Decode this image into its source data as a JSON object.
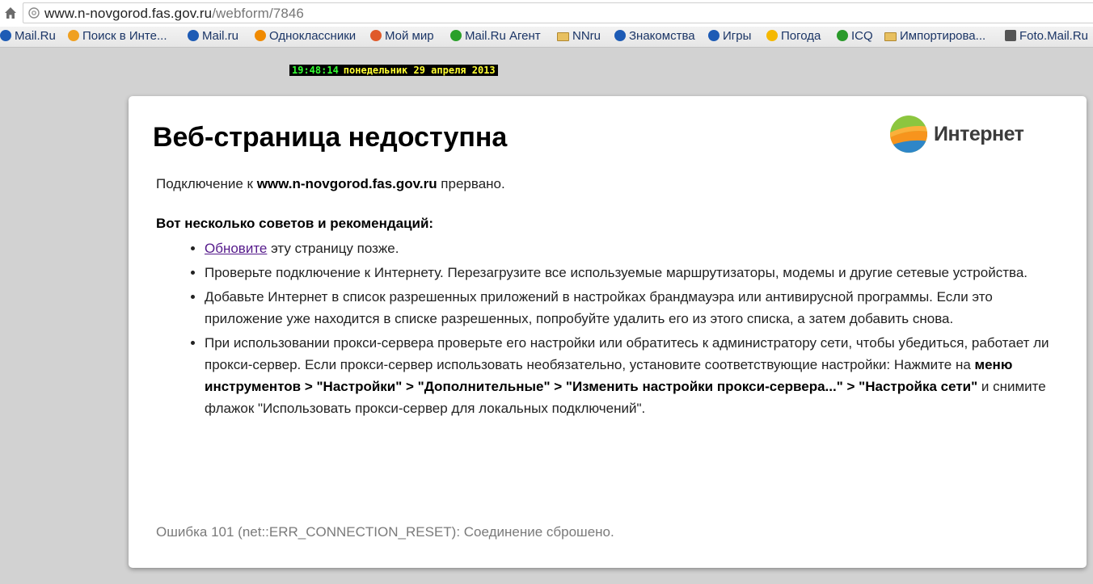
{
  "address_bar": {
    "url_host": "www.n-novgorod.fas.gov.ru",
    "url_path": "/webform/7846"
  },
  "bookmarks": [
    {
      "label": "Mail.Ru",
      "icon": "mailru-at-icon",
      "color": "#1d5bb5"
    },
    {
      "label": "Поиск в Инте...",
      "icon": "search-icon",
      "color": "#f0a020"
    },
    {
      "label": "Mail.ru",
      "icon": "mailru-at-icon",
      "color": "#1d5bb5"
    },
    {
      "label": "Одноклассники",
      "icon": "odnoklassniki-icon",
      "color": "#f08a00"
    },
    {
      "label": "Мой мир",
      "icon": "people-icon",
      "color": "#e05a2a"
    },
    {
      "label": "Mail.Ru Агент",
      "icon": "agent-icon",
      "color": "#2aa02a"
    },
    {
      "label": "NNru",
      "icon": "folder-icon",
      "color": "#e8c060"
    },
    {
      "label": "Знакомства",
      "icon": "at-icon",
      "color": "#1d5bb5"
    },
    {
      "label": "Игры",
      "icon": "mailru-at-icon",
      "color": "#1d5bb5"
    },
    {
      "label": "Погода",
      "icon": "weather-icon",
      "color": "#f5b800"
    },
    {
      "label": "ICQ",
      "icon": "icq-flower-icon",
      "color": "#2a9a2a"
    },
    {
      "label": "Импортирова...",
      "icon": "folder-icon",
      "color": "#e8c060"
    },
    {
      "label": "Foto.Mail.Ru",
      "icon": "camera-icon",
      "color": "#555555"
    }
  ],
  "clock": {
    "time": "19:48:14",
    "date": "понедельник 29 апреля 2013"
  },
  "page": {
    "title": "Веб-страница недоступна",
    "logo_text": "Интернет",
    "message_prefix": "Подключение к ",
    "message_host": "www.n-novgorod.fas.gov.ru",
    "message_suffix": " прервано.",
    "tips_heading": "Вот несколько советов и рекомендаций:",
    "tip1_link": "Обновите",
    "tip1_rest": " эту страницу позже.",
    "tip2": "Проверьте подключение к Интернету. Перезагрузите все используемые маршрутизаторы, модемы и другие сетевые устройства.",
    "tip3": "Добавьте Интернет в список разрешенных приложений в настройках брандмауэра или антивирусной программы. Если это приложение уже находится в списке разрешенных, попробуйте удалить его из этого списка, а затем добавить снова.",
    "tip4_text1": "При использовании прокси-сервера проверьте его настройки или обратитесь к администратору сети, чтобы убедиться, работает ли прокси-сервер. Если прокси-сервер использовать необязательно, установите соответствующие настройки: Нажмите на ",
    "tip4_bold1": "меню инструментов > \"Настройки\" > \"Дополнительные\" > \"Изменить настройки прокси-сервера...\" > \"Настройка сети\"",
    "tip4_text2": " и снимите флажок \"Использовать прокси-сервер для локальных подключений\".",
    "error": "Ошибка 101 (net::ERR_CONNECTION_RESET): Соединение сброшено."
  }
}
